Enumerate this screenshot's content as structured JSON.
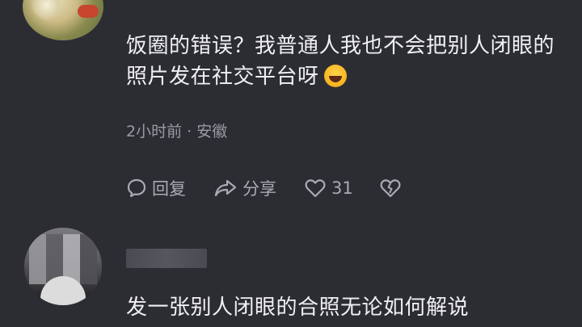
{
  "comments": [
    {
      "text": "饭圈的错误？我普通人我也不会把别人闭眼的照片发在社交平台呀",
      "emoji_icon": "rolling-laughing-emoji",
      "time": "2小时前",
      "separator": "·",
      "location": "安徽",
      "actions": {
        "reply_label": "回复",
        "share_label": "分享",
        "like_count": "31"
      }
    },
    {
      "text": "发一张别人闭眼的合照无论如何解说"
    }
  ],
  "colors": {
    "background": "#2c2d33",
    "text": "#f0f0f4",
    "meta": "#9a9ba3",
    "action": "#a9aab2"
  }
}
